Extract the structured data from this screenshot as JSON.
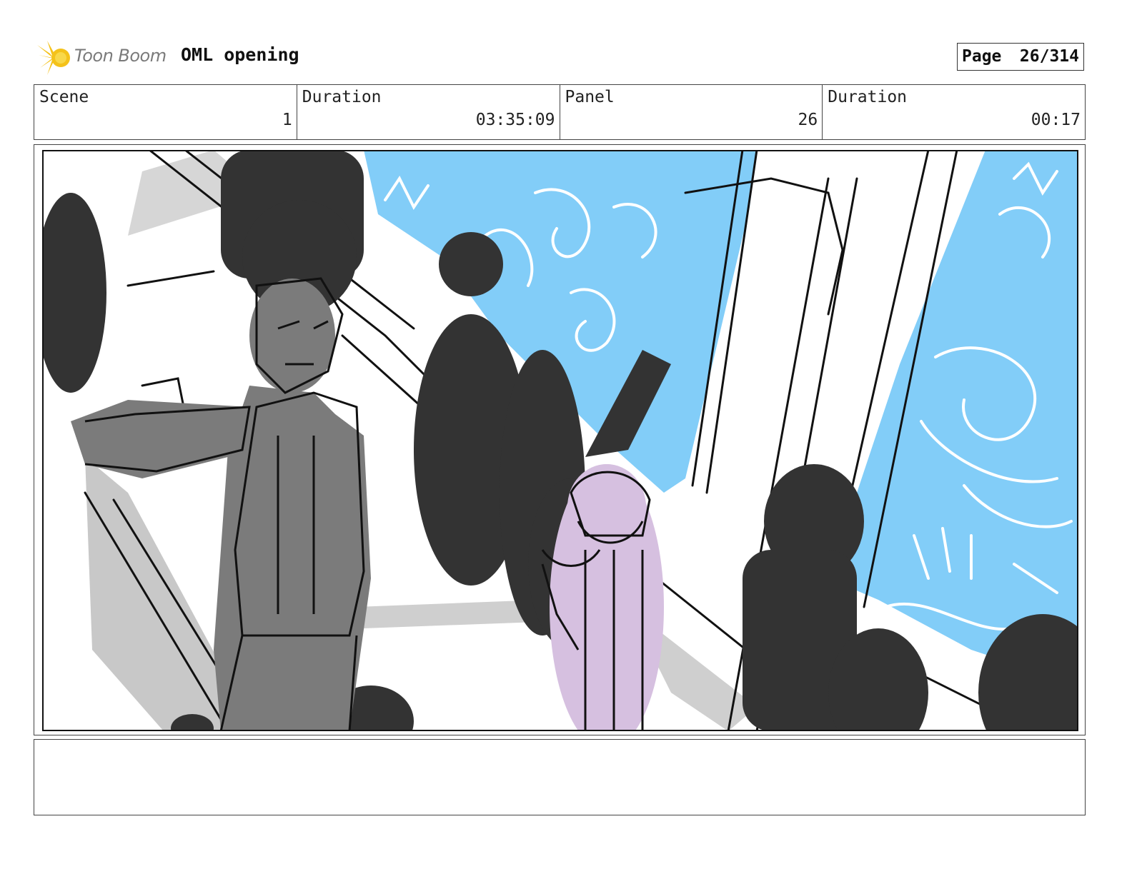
{
  "header": {
    "logo_text": "Toon Boom",
    "project_title": "OML opening",
    "page_label": "Page",
    "page_number": "26/314"
  },
  "info": {
    "scene_label": "Scene",
    "scene_value": "1",
    "duration_label": "Duration",
    "duration_value": "03:35:09",
    "panel_label": "Panel",
    "panel_value": "26",
    "panel_duration_label": "Duration",
    "panel_duration_value": "00:17"
  },
  "colors": {
    "sky_blue": "#82cdf8",
    "silhouette": "#333333",
    "figure_grey": "#7b7b7b",
    "floor_grey": "#c8c8c8",
    "lilac": "#d6c0e0",
    "logo_yellow": "#f4c21a"
  },
  "icons": {
    "logo": "toon-boom-star-icon"
  },
  "notes": {
    "text": ""
  }
}
